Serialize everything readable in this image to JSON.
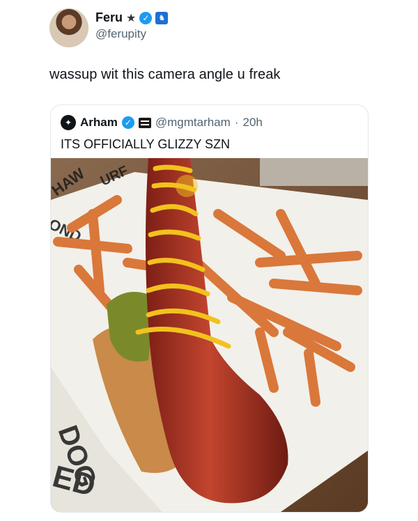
{
  "author": {
    "name": "Feru",
    "name_suffix": "★",
    "handle": "@ferupity"
  },
  "tweet_text": "wassup wit this camera angle u freak",
  "quoted_tweet": {
    "name": "Arham",
    "handle": "@mgmtarham",
    "separator": "·",
    "time": "20h",
    "text": "ITS OFFICIALLY GLIZZY SZN",
    "image": {
      "description_icon": "photo-hotdog-fries",
      "wrapper_text": [
        "HAW",
        "URF",
        "OND",
        "DOG",
        "ED"
      ]
    }
  },
  "colors": {
    "verified_blue": "#1d9bf0",
    "secondary_text": "#536471",
    "border": "#e4e7ea"
  }
}
